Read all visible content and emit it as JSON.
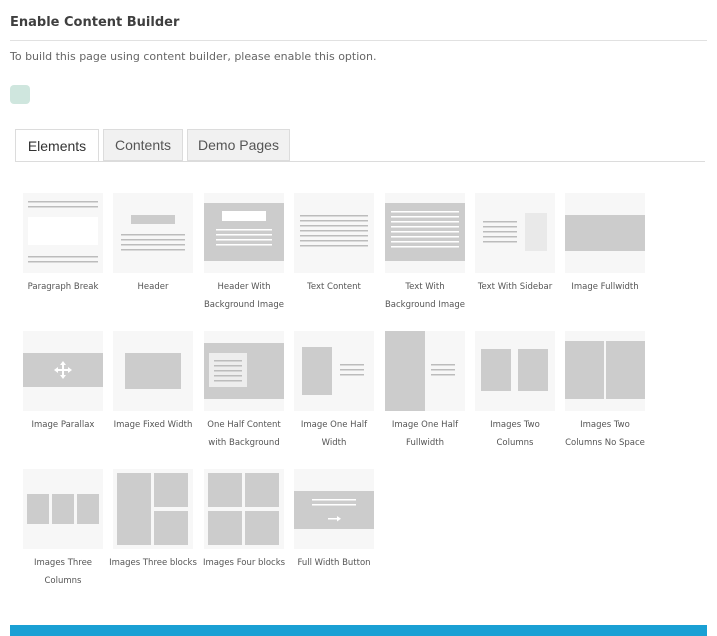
{
  "header": {
    "title": "Enable Content Builder",
    "description": "To build this page using content builder, please enable this option."
  },
  "tabs": [
    {
      "label": "Elements",
      "active": true
    },
    {
      "label": "Contents",
      "active": false
    },
    {
      "label": "Demo Pages",
      "active": false
    }
  ],
  "colors": {
    "toggle": "#cfe6de",
    "tile_bg": "#f7f7f7",
    "shape": "#cccccc",
    "line": "#bcbcbc",
    "accent_bar": "#1aa0d4"
  },
  "elements": [
    {
      "label_lines": [
        "Paragraph Break"
      ],
      "icon": "paragraph-break-icon"
    },
    {
      "label_lines": [
        "Header"
      ],
      "icon": "header-icon"
    },
    {
      "label_lines": [
        "Header With",
        "Background Image"
      ],
      "icon": "header-background-image-icon"
    },
    {
      "label_lines": [
        "Text Content"
      ],
      "icon": "text-content-icon"
    },
    {
      "label_lines": [
        "Text With",
        "Background Image"
      ],
      "icon": "text-background-image-icon"
    },
    {
      "label_lines": [
        "Text With Sidebar"
      ],
      "icon": "text-sidebar-icon"
    },
    {
      "label_lines": [
        "Image Fullwidth"
      ],
      "icon": "image-fullwidth-icon"
    },
    {
      "label_lines": [
        "Image Parallax"
      ],
      "icon": "image-parallax-icon"
    },
    {
      "label_lines": [
        "Image Fixed Width"
      ],
      "icon": "image-fixed-width-icon"
    },
    {
      "label_lines": [
        "One Half Content",
        "with Background"
      ],
      "icon": "one-half-content-background-icon"
    },
    {
      "label_lines": [
        "Image One Half",
        "Width"
      ],
      "icon": "image-one-half-width-icon"
    },
    {
      "label_lines": [
        "Image One Half",
        "Fullwidth"
      ],
      "icon": "image-one-half-fullwidth-icon"
    },
    {
      "label_lines": [
        "Images Two",
        "Columns"
      ],
      "icon": "images-two-columns-icon"
    },
    {
      "label_lines": [
        "Images Two",
        "Columns No Space"
      ],
      "icon": "images-two-columns-no-space-icon"
    },
    {
      "label_lines": [
        "Images Three",
        "Columns"
      ],
      "icon": "images-three-columns-icon"
    },
    {
      "label_lines": [
        "Images Three blocks"
      ],
      "icon": "images-three-blocks-icon"
    },
    {
      "label_lines": [
        "Images Four blocks"
      ],
      "icon": "images-four-blocks-icon"
    },
    {
      "label_lines": [
        "Full Width Button"
      ],
      "icon": "full-width-button-icon"
    }
  ]
}
